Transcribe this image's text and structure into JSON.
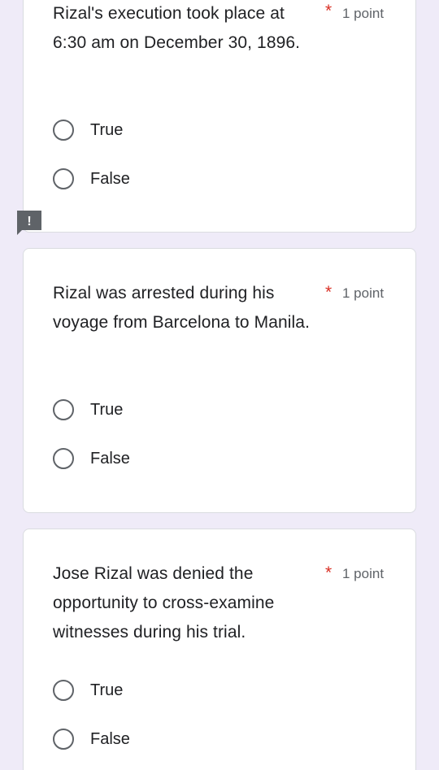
{
  "questions": [
    {
      "text": "Rizal's execution took place at 6:30 am on December 30, 1896.",
      "required_mark": "*",
      "points": "1 point",
      "options": [
        "True",
        "False"
      ]
    },
    {
      "text": "Rizal was arrested during his voyage from Barcelona to Manila.",
      "required_mark": "*",
      "points": "1 point",
      "options": [
        "True",
        "False"
      ]
    },
    {
      "text": "Jose Rizal was denied the opportunity to cross-examine witnesses during his trial.",
      "required_mark": "*",
      "points": "1 point",
      "options": [
        "True",
        "False"
      ]
    }
  ],
  "error_flag": {
    "glyph": "!"
  },
  "colors": {
    "background": "#efebf8",
    "required": "#d93025",
    "error_flag": "#5f6368"
  },
  "icons": [
    "radio-button-icon",
    "error-flag-icon"
  ]
}
